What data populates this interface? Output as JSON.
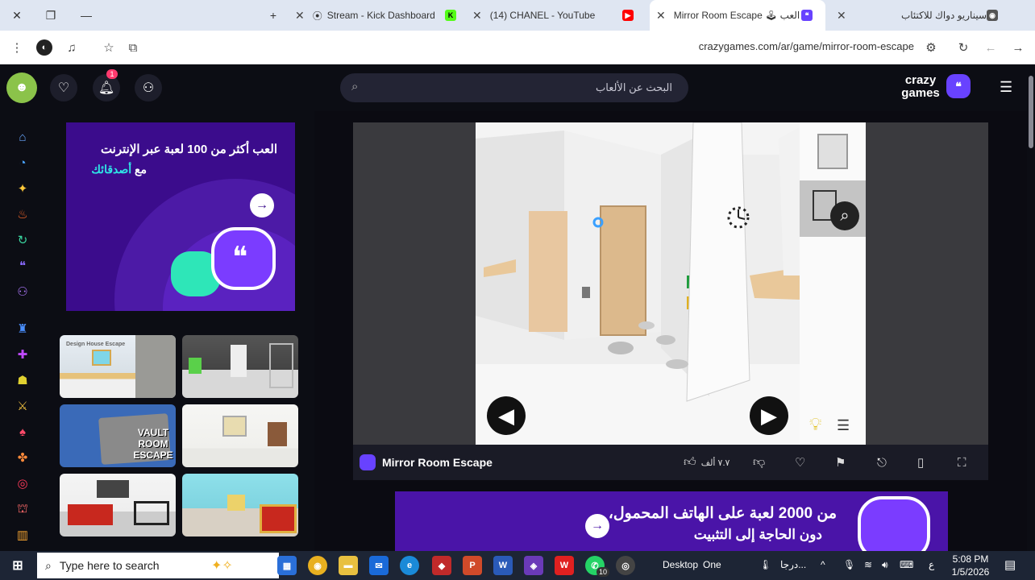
{
  "browser": {
    "tabs": [
      {
        "title": "Stream - Kick Dashboard",
        "fav_color": "#53fc18"
      },
      {
        "title": "(14) CHANEL - YouTube",
        "fav_color": "#ff0000"
      },
      {
        "title": "Mirror Room Escape 🕹 العب",
        "fav_color": "#6842ff"
      },
      {
        "title": "سيناريو دواك للاكتئاب",
        "fav_color": "#555555"
      }
    ],
    "url": "crazygames.com/ar/game/mirror-room-escape"
  },
  "site": {
    "search_placeholder": "البحث عن الألعاب",
    "logo_line1": "crazy",
    "logo_line2": "games",
    "notif_count": "1"
  },
  "promo": {
    "line1": "العب أكثر من 100 لعبة عبر الإنترنت",
    "line2_prefix": "مع",
    "line2_highlight": "أصدقائك",
    "highlight_color": "#2ee6e6"
  },
  "thumbs": [
    {
      "label": "Design House Escape"
    },
    {
      "label": ""
    },
    {
      "label": "VAULT ROOM ESCAPE"
    },
    {
      "label": ""
    },
    {
      "label": ""
    },
    {
      "label": ""
    }
  ],
  "game": {
    "title": "Mirror Room Escape",
    "likes": "٧.٧ ألف"
  },
  "banner": {
    "line1": "من 2000 لعبة على الهاتف المحمول،",
    "line2": "دون الحاجة إلى التثبيت"
  },
  "taskbar": {
    "search_placeholder": "Type here to search",
    "desktop_label": "Desktop",
    "onedrive_label": "One",
    "weather_label": "درجا...",
    "lang": "ع",
    "time": "5:08 PM",
    "date": "1/5/2026",
    "badge_count": "10"
  },
  "colors": {
    "brand": "#6842ff",
    "bg": "#0c0d14"
  }
}
